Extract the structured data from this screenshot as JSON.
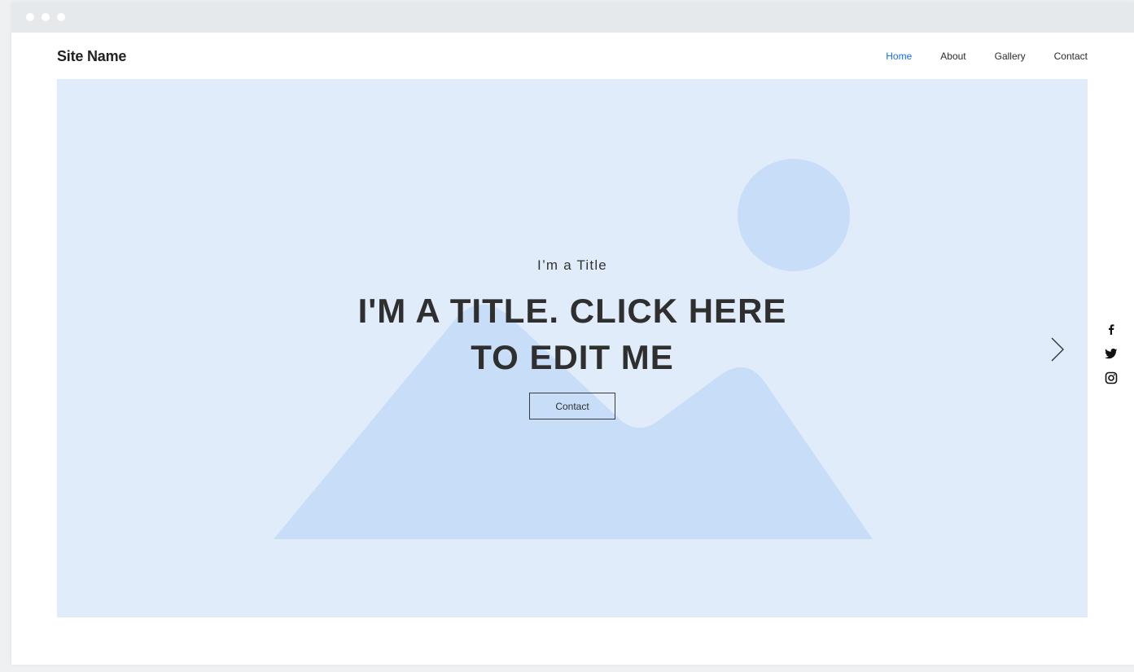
{
  "header": {
    "site_name": "Site Name"
  },
  "nav": {
    "items": [
      {
        "label": "Home",
        "active": true
      },
      {
        "label": "About",
        "active": false
      },
      {
        "label": "Gallery",
        "active": false
      },
      {
        "label": "Contact",
        "active": false
      }
    ]
  },
  "hero": {
    "subtitle": "I’m a Title",
    "headline_line1": "I'M A TITLE. CLICK HERE",
    "headline_line2": "TO EDIT ME",
    "cta_label": "Contact"
  },
  "icons": {
    "browser_dots": [
      "window-dot-icon",
      "window-dot-icon",
      "window-dot-icon"
    ],
    "slider_next": "chevron-right-icon",
    "hero_image": "image-placeholder-icon",
    "social": [
      "facebook-icon",
      "twitter-icon",
      "instagram-icon"
    ]
  },
  "colors": {
    "accent": "#116dff",
    "hero_bg": "#e0ecfa",
    "placeholder_shape": "#c8ddf8",
    "text": "#2f2f2f"
  }
}
